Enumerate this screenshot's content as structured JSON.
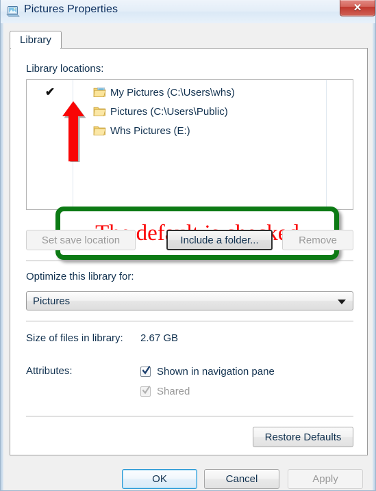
{
  "window": {
    "title": "Pictures Properties",
    "icon": "library-pictures-icon",
    "close_label": "✕"
  },
  "tabs": [
    {
      "label": "Library",
      "active": true
    }
  ],
  "library": {
    "locations_label": "Library locations:",
    "locations": [
      {
        "checked": true,
        "check_glyph": "✔",
        "icon": "pictures-folder-icon",
        "name": "My Pictures (C:\\Users\\whs)"
      },
      {
        "checked": false,
        "check_glyph": "",
        "icon": "folder-icon",
        "name": "Pictures (C:\\Users\\Public)"
      },
      {
        "checked": false,
        "check_glyph": "",
        "icon": "folder-icon",
        "name": "Whs Pictures (E:)"
      }
    ],
    "buttons": {
      "set_save_location": "Set save location",
      "include_a_folder": "Include a folder...",
      "remove": "Remove"
    },
    "optimize_label": "Optimize this library for:",
    "optimize_value": "Pictures",
    "optimize_options": [
      "Pictures"
    ],
    "size_label": "Size of files in library:",
    "size_value": "2.67 GB",
    "attributes_label": "Attributes:",
    "attributes": [
      {
        "label": "Shown in navigation pane",
        "checked": true,
        "disabled": false
      },
      {
        "label": "Shared",
        "checked": true,
        "disabled": true
      }
    ],
    "restore_defaults": "Restore Defaults"
  },
  "dialog_buttons": {
    "ok": "OK",
    "cancel": "Cancel",
    "apply": "Apply"
  },
  "annotation": {
    "text": "The default is checked",
    "border_color": "#0c7a14",
    "text_color": "#fb0000",
    "arrow_color": "#f90505"
  }
}
